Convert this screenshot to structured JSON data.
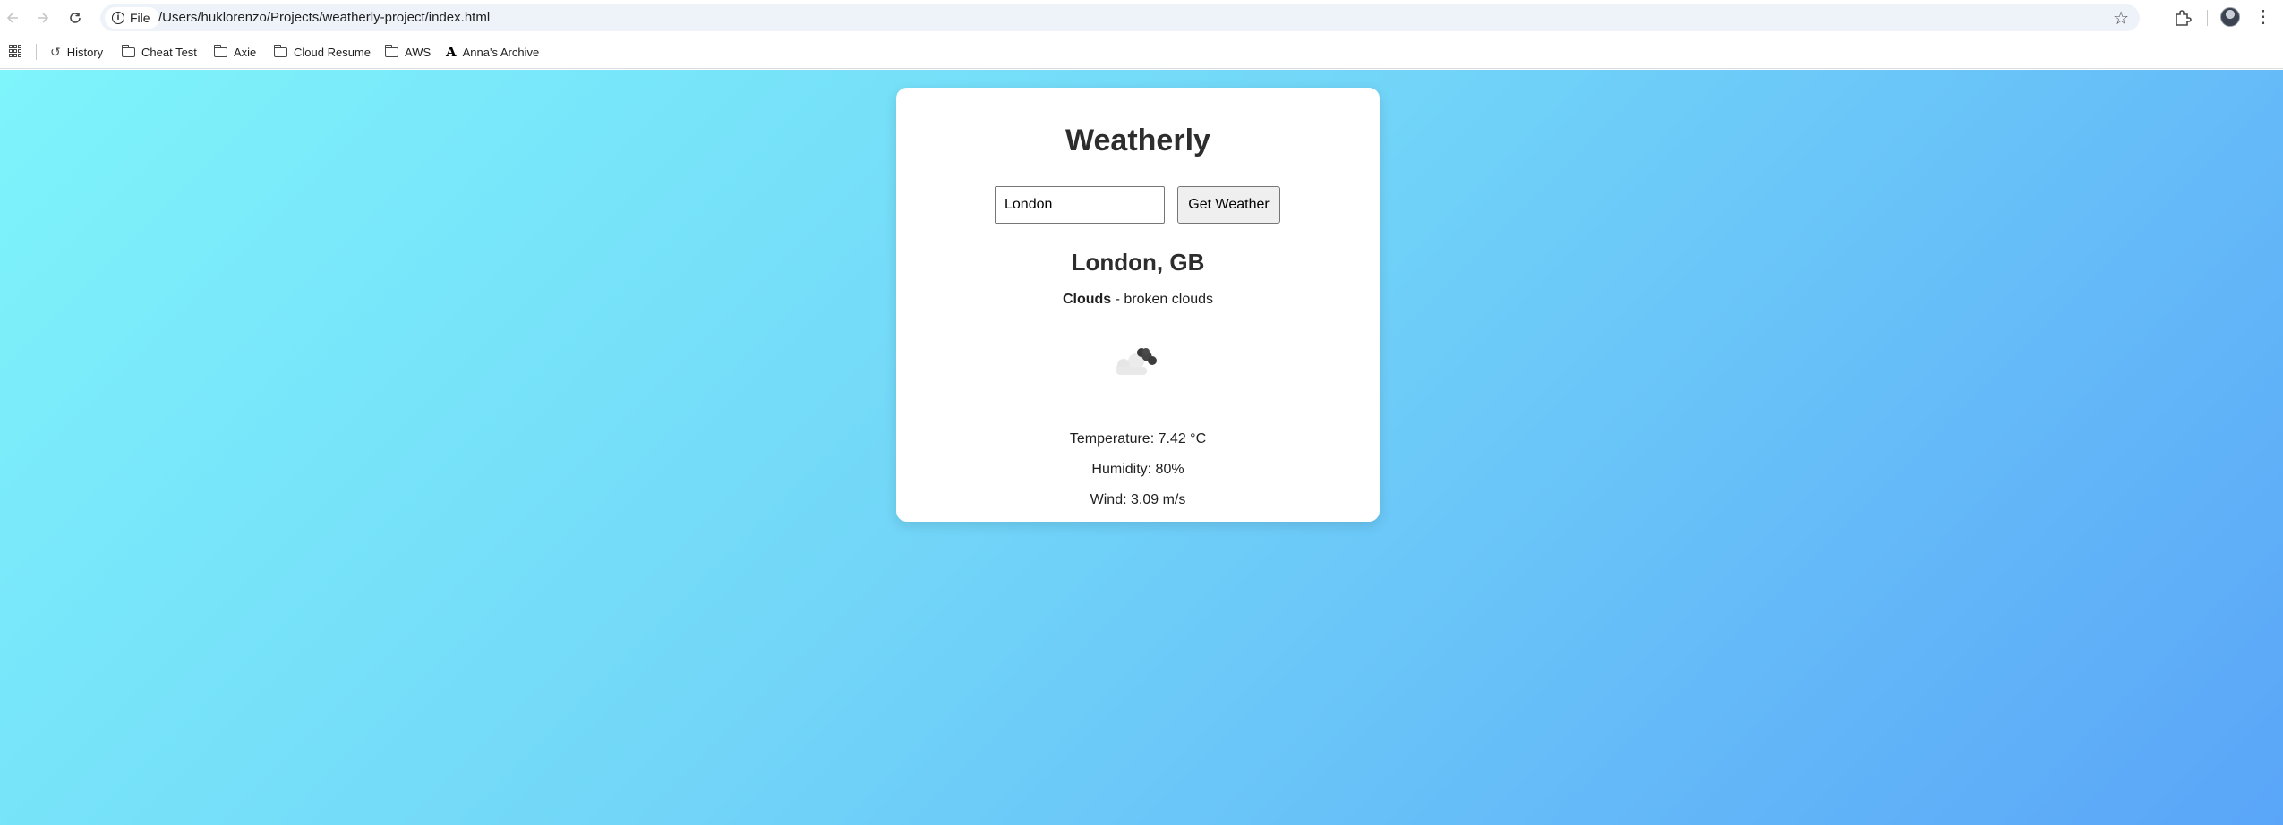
{
  "browser": {
    "url_scheme_label": "File",
    "url": "/Users/huklorenzo/Projects/weatherly-project/index.html"
  },
  "bookmarks": [
    {
      "label": "History",
      "icon": "history-icon"
    },
    {
      "label": "Cheat Test",
      "icon": "folder-icon"
    },
    {
      "label": "Axie",
      "icon": "folder-icon"
    },
    {
      "label": "Cloud Resume",
      "icon": "folder-icon"
    },
    {
      "label": "AWS",
      "icon": "folder-icon"
    },
    {
      "label": "Anna's Archive",
      "icon": "anna-icon"
    }
  ],
  "app": {
    "title": "Weatherly",
    "search_value": "London",
    "button_label": "Get Weather"
  },
  "weather": {
    "location": "London, GB",
    "main": "Clouds",
    "separator": " - ",
    "description": "broken clouds",
    "icon": "broken-clouds-icon",
    "temperature": "Temperature: 7.42 °C",
    "humidity": "Humidity: 80%",
    "wind": "Wind: 3.09 m/s"
  },
  "colors": {
    "gradient_start": "#7ef4fb",
    "gradient_end": "#5aa5f8",
    "card": "#ffffff",
    "title": "#2d2d2d"
  }
}
